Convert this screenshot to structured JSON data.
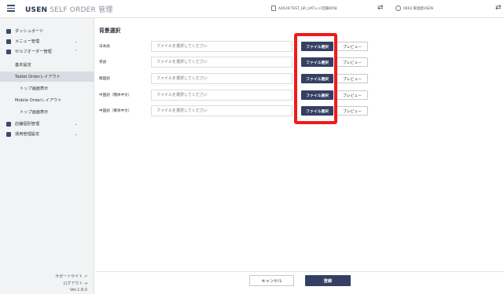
{
  "header": {
    "brand_bold": "USEN",
    "brand_light": "SELF ORDER 管理",
    "store_label": "A4028:TEST_GR_UATレジ店舗0058",
    "user_label": "0002:東酒屋USEN"
  },
  "sidebar": {
    "items": [
      {
        "label": "ダッシュボード",
        "icon": "dashboard-icon"
      },
      {
        "label": "メニュー管理",
        "icon": "menu-book-icon",
        "chevron": "⌄"
      },
      {
        "label": "セルフオーダー管理",
        "icon": "tablet-icon",
        "chevron": "⌃"
      },
      {
        "label": "基本設定"
      },
      {
        "label": "Tablet Orderレイアウト"
      },
      {
        "label": "トップ画面表示"
      },
      {
        "label": "Mobile Orderレイアウト"
      },
      {
        "label": "トップ画面表示"
      },
      {
        "label": "店舗個別管理",
        "icon": "store-icon",
        "chevron": "⌄"
      },
      {
        "label": "運用管理設定",
        "icon": "settings-icon",
        "chevron": "⌄"
      }
    ],
    "support_link": "サポートサイト",
    "logout_link": "ログアウト",
    "version": "Ver.1.8.0"
  },
  "main": {
    "section_title": "背景選択",
    "placeholder": "ファイルを選択してください",
    "select_label": "ファイル選択",
    "preview_label": "プレビュー",
    "rows": [
      {
        "label": "日本語"
      },
      {
        "label": "英語"
      },
      {
        "label": "韓国語"
      },
      {
        "label": "中国語（簡体中文）"
      },
      {
        "label": "中国語（繁体中文）"
      }
    ]
  },
  "footer": {
    "cancel_label": "キャンセル",
    "register_label": "登録"
  },
  "colors": {
    "accent": "#344063",
    "highlight": "#ee1c1c",
    "sidebar_bg": "#f2f3f5"
  }
}
